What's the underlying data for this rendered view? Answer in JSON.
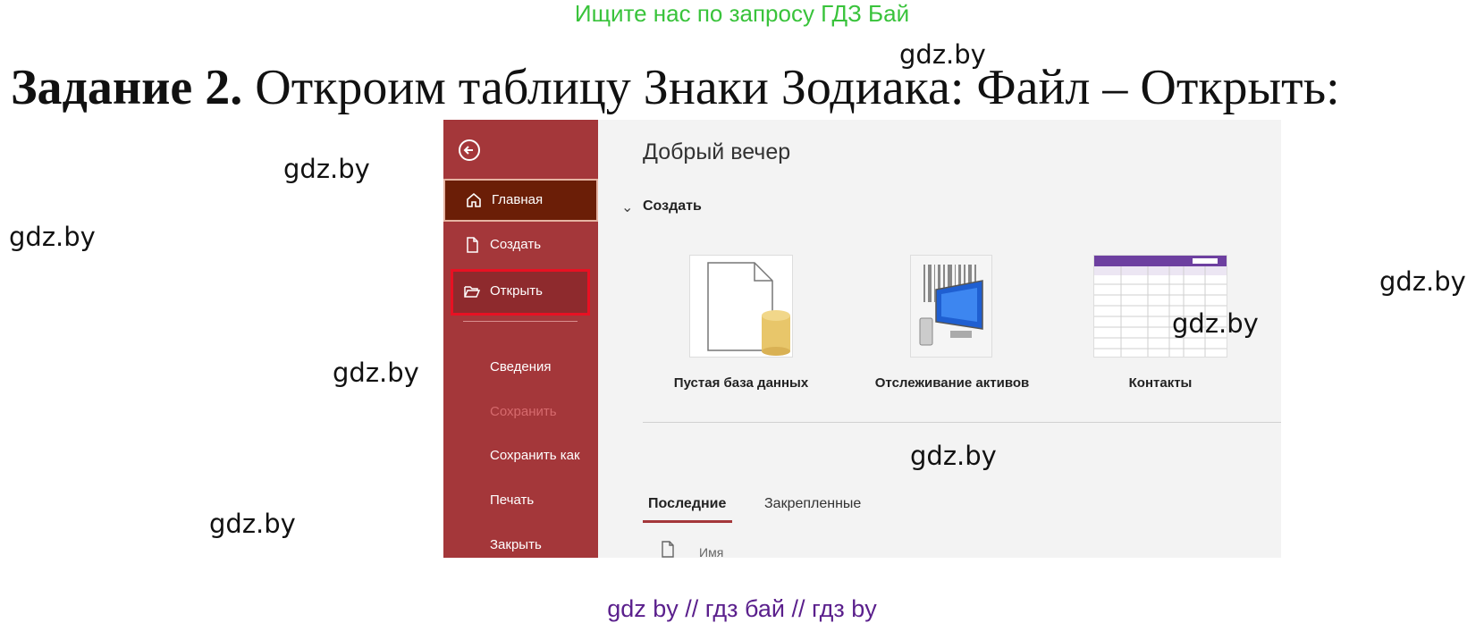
{
  "banner": "Ищите нас по запросу ГДЗ Бай",
  "heading": {
    "bold": "Задание 2.",
    "rest": " Откроим таблицу Знаки Зодиака: Файл – Открыть:"
  },
  "watermark": "gdz.by",
  "footer": "gdz by  //  гдз бай  //  гдз by",
  "app": {
    "greeting": "Добрый вечер",
    "nav": {
      "home": "Главная",
      "create": "Создать",
      "open": "Открыть",
      "info": "Сведения",
      "save": "Сохранить",
      "save_as": "Сохранить как",
      "print": "Печать",
      "close": "Закрыть"
    },
    "section": "Создать",
    "templates": [
      "Пустая база данных",
      "Отслеживание активов",
      "Контакты"
    ],
    "tabs": {
      "recent": "Последние",
      "pinned": "Закрепленные"
    },
    "column_name": "Имя",
    "colors": {
      "sidebar": "#a4373a",
      "active": "#6b1e07",
      "highlight": "#e81123"
    }
  }
}
